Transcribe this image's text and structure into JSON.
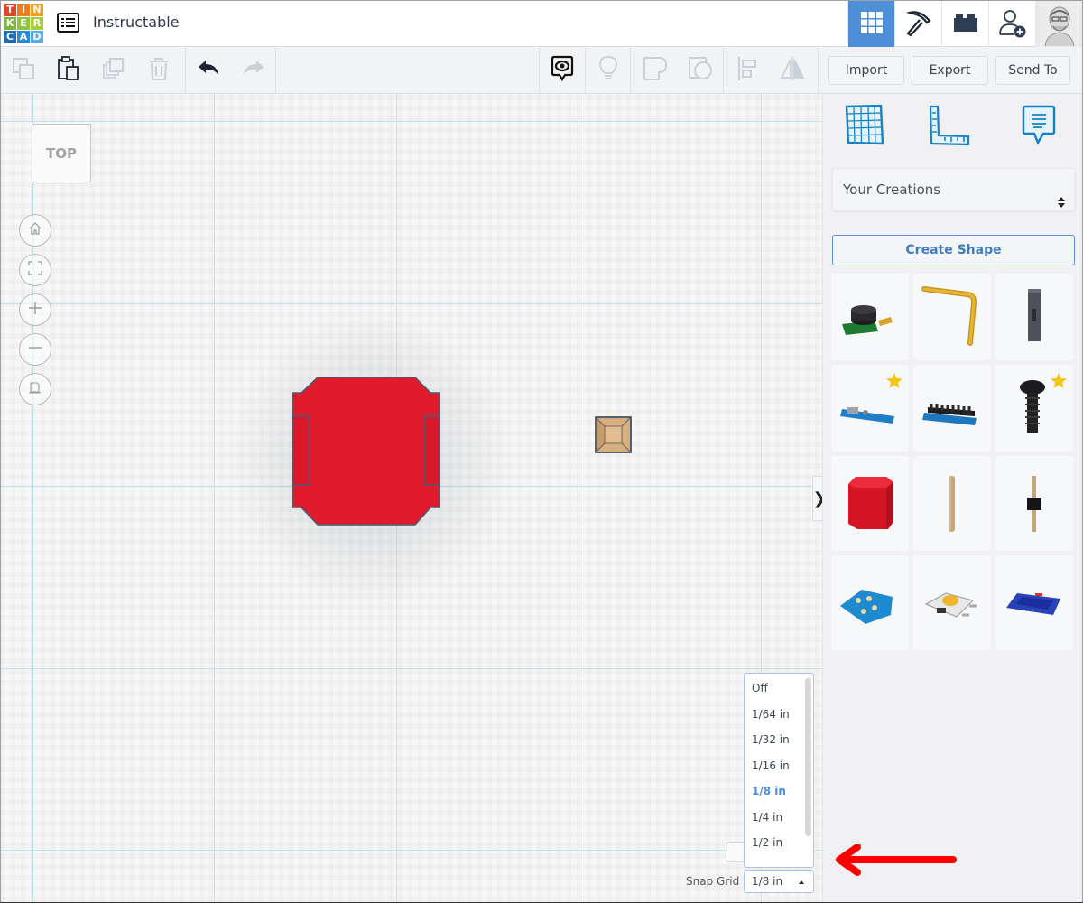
{
  "app": {
    "logo_letters": [
      "T",
      "I",
      "N",
      "K",
      "E",
      "R",
      "C",
      "A",
      "D"
    ],
    "logo_colors": [
      "#e2452a",
      "#f07c1e",
      "#f29e1e",
      "#7cb63e",
      "#8cc63f",
      "#a6ce39",
      "#1e6db8",
      "#2d8ad6",
      "#5aacea"
    ],
    "document_title": "Instructable",
    "accent_color": "#4f8fd9"
  },
  "header": {
    "menu_icon": "list-menu-icon",
    "buttons": [
      {
        "name": "3d-design-view",
        "icon": "grid-icon",
        "active": true
      },
      {
        "name": "blocks-editor",
        "icon": "pickaxe-icon",
        "active": false
      },
      {
        "name": "bricks-view",
        "icon": "brick-icon",
        "active": false
      },
      {
        "name": "invite-user",
        "icon": "add-user-icon",
        "active": false
      }
    ],
    "avatar": "user-avatar"
  },
  "toolbar": {
    "left_icons": [
      "copy-icon",
      "paste-icon",
      "duplicate-icon",
      "delete-icon",
      "undo-icon",
      "redo-icon"
    ],
    "right_icons": [
      "notes-visibility-icon",
      "light-bulb-icon",
      "group-icon",
      "ungroup-icon",
      "align-icon",
      "mirror-icon"
    ],
    "import_label": "Import",
    "export_label": "Export",
    "send_to_label": "Send To"
  },
  "canvas": {
    "view_cube_label": "TOP",
    "nav_buttons": [
      "home-view",
      "fit-all",
      "zoom-in",
      "zoom-out",
      "orthographic-view"
    ],
    "panel_toggle": "❯"
  },
  "snap_grid": {
    "label": "Snap Grid",
    "selected": "1/8 in",
    "options": [
      "Off",
      "1/64 in",
      "1/32 in",
      "1/16 in",
      "1/8 in",
      "1/4 in",
      "1/2 in"
    ]
  },
  "right_panel": {
    "tabs": [
      "workplane-icon",
      "ruler-icon",
      "notes-icon"
    ],
    "library_selected": "Your Creations",
    "create_shape_label": "Create Shape",
    "shapes": [
      {
        "name": "buzzer-module",
        "starred": false
      },
      {
        "name": "bent-rod",
        "starred": false
      },
      {
        "name": "jumper-connector",
        "starred": false
      },
      {
        "name": "blue-board-sensor",
        "starred": true
      },
      {
        "name": "arduino-nano-board",
        "starred": false
      },
      {
        "name": "screw",
        "starred": true
      },
      {
        "name": "red-box",
        "starred": false
      },
      {
        "name": "wood-dowel",
        "starred": false
      },
      {
        "name": "header-pin",
        "starred": false
      },
      {
        "name": "led-matrix-board",
        "starred": false
      },
      {
        "name": "tactile-switch",
        "starred": false
      },
      {
        "name": "oled-display",
        "starred": false
      }
    ]
  }
}
